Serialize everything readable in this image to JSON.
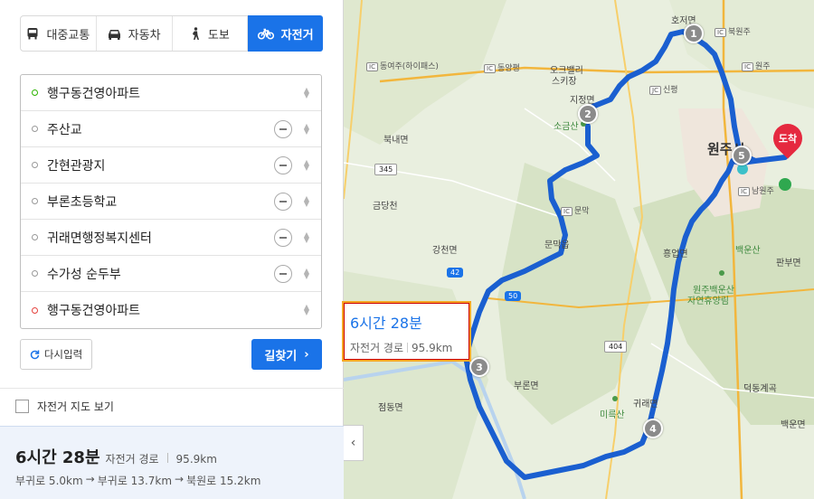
{
  "tabs": [
    {
      "label": "대중교통",
      "icon": "bus-icon",
      "active": false
    },
    {
      "label": "자동차",
      "icon": "car-icon",
      "active": false
    },
    {
      "label": "도보",
      "icon": "walk-icon",
      "active": false
    },
    {
      "label": "자전거",
      "icon": "bicycle-icon",
      "active": true
    }
  ],
  "waypoints": [
    {
      "name": "행구동건영아파트",
      "role": "start"
    },
    {
      "name": "주산교",
      "role": "via"
    },
    {
      "name": "간현관광지",
      "role": "via"
    },
    {
      "name": "부론초등학교",
      "role": "via"
    },
    {
      "name": "귀래면행정복지센터",
      "role": "via"
    },
    {
      "name": "수가성 순두부",
      "role": "via"
    },
    {
      "name": "행구동건영아파트",
      "role": "end"
    }
  ],
  "buttons": {
    "reset": "다시입력",
    "search": "길찾기"
  },
  "bike_map_toggle": {
    "label": "자전거 지도 보기",
    "checked": false
  },
  "summary": {
    "time": "6시간 28분",
    "type": "자전거 경로",
    "distance": "95.9km",
    "segments": [
      "부귀로 5.0km",
      "→",
      "부귀로 13.7km",
      "→",
      "북원로 15.2km"
    ]
  },
  "map": {
    "route_box": {
      "time": "6시간 28분",
      "type": "자전거 경로",
      "distance": "95.9km"
    },
    "markers": [
      "1",
      "2",
      "3",
      "4",
      "5"
    ],
    "destination": "도착",
    "route_color": "#1a5fd0",
    "labels": {
      "city": "원주시",
      "places": [
        "호저면",
        "북원주",
        "원주",
        "동여주(하이패스)",
        "동양평",
        "오크밸리",
        "스키장",
        "지정면",
        "소금산",
        "신평",
        "원주",
        "북내면",
        "금당천",
        "문막",
        "강천면",
        "문막읍",
        "흥업면",
        "백운산",
        "원주백운산",
        "자연휴양림",
        "판부면",
        "부론면",
        "점동면",
        "귀래면",
        "미륵산",
        "덕동계곡",
        "백운면",
        "남원주"
      ],
      "roads": [
        "345",
        "42",
        "50",
        "404"
      ]
    }
  },
  "colors": {
    "accent": "#1a73e8",
    "start": "#2db400",
    "end": "#e5413c"
  }
}
